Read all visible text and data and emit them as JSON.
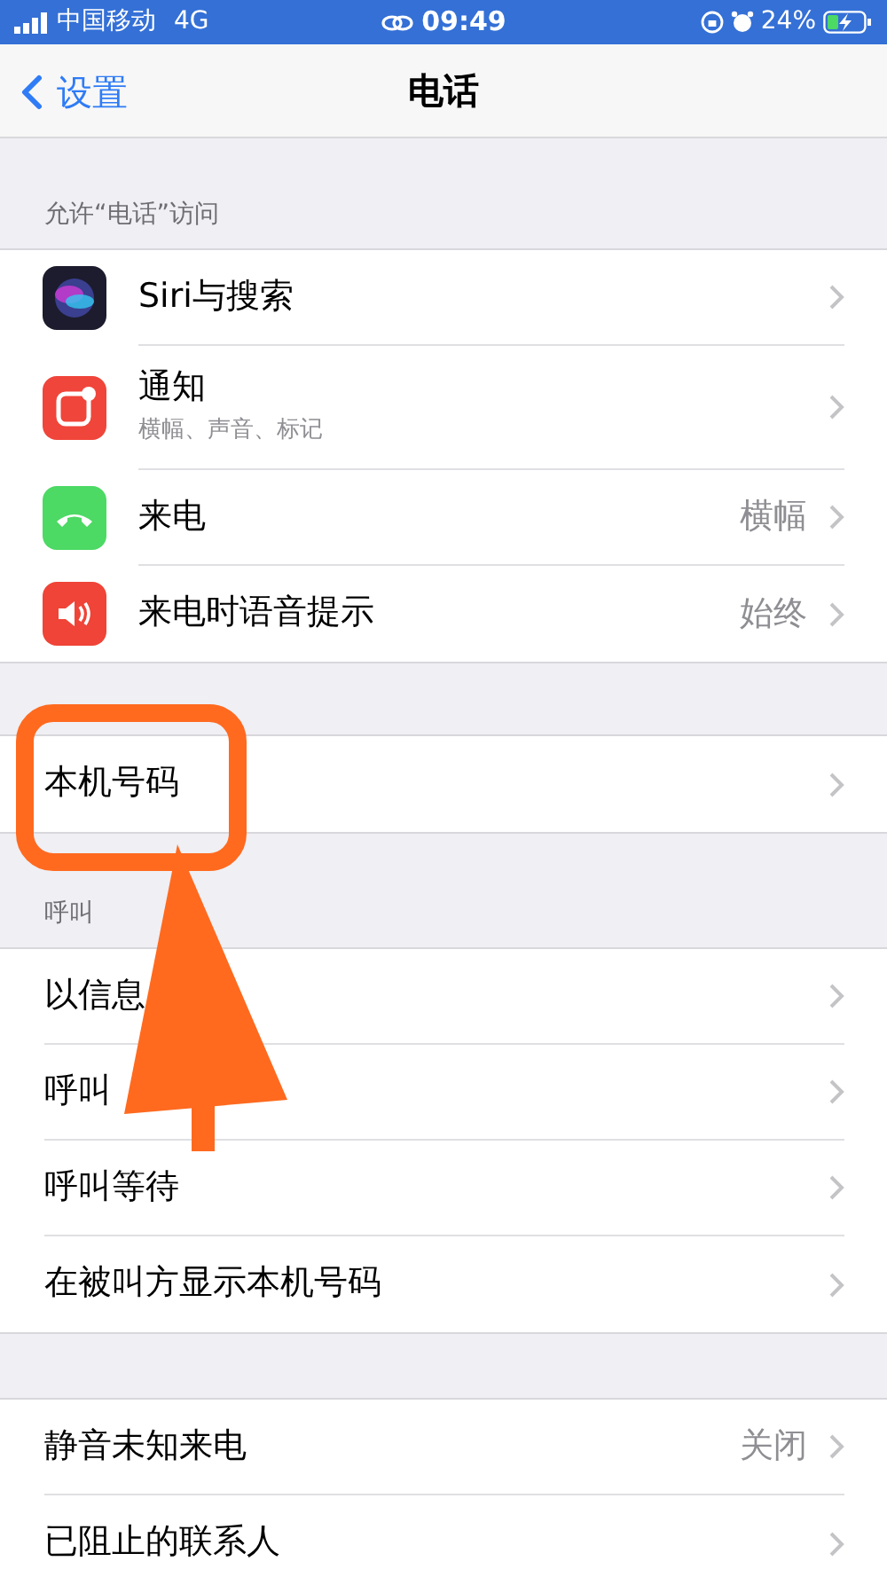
{
  "status_bar": {
    "carrier": "中国移动",
    "network": "4G",
    "time": "09:49",
    "battery": "24%"
  },
  "nav": {
    "back": "设置",
    "title": "电话"
  },
  "sections": [
    {
      "header": "允许“电话”访问",
      "rows": [
        {
          "kind": "siri",
          "label": "Siri与搜索"
        },
        {
          "kind": "notifications",
          "label": "通知",
          "subtitle": "横幅、声音、标记"
        },
        {
          "kind": "phone",
          "label": "来电",
          "value": "横幅"
        },
        {
          "kind": "speaker",
          "label": "来电时语音提示",
          "value": "始终"
        }
      ]
    },
    {
      "rows": [
        {
          "label": "本机号码"
        }
      ]
    },
    {
      "header": "呼叫",
      "rows": [
        {
          "label": "以信息"
        },
        {
          "label": "呼叫"
        },
        {
          "label": "呼叫等待"
        },
        {
          "label": "在被叫方显示本机号码"
        }
      ]
    },
    {
      "rows": [
        {
          "label": "静音未知来电",
          "value": "关闭"
        },
        {
          "label": "已阻止的联系人"
        }
      ]
    }
  ]
}
